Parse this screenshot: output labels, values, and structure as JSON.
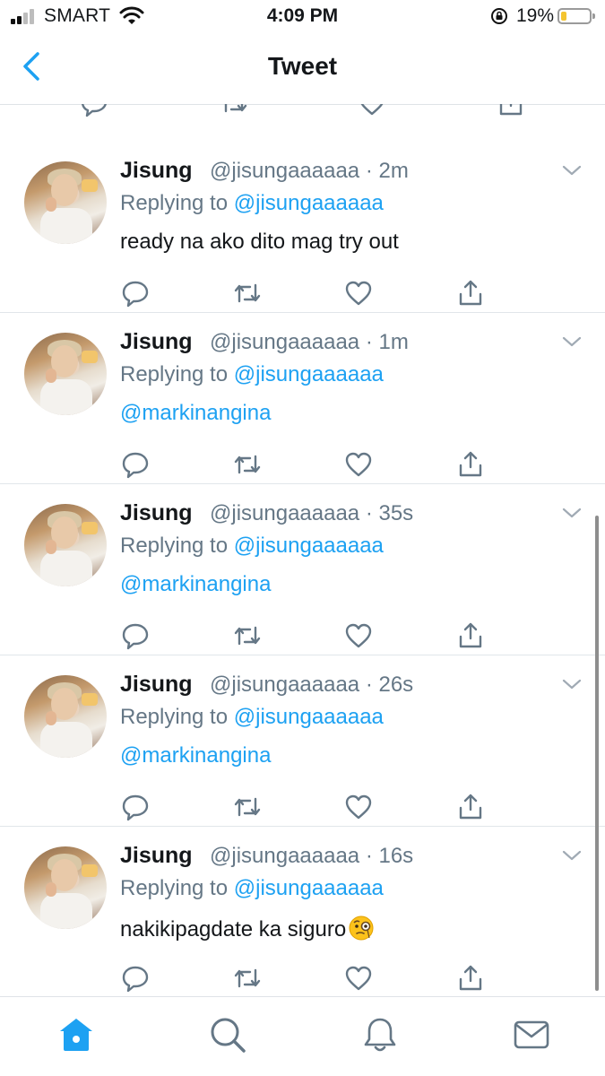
{
  "status_bar": {
    "carrier": "SMART",
    "time": "4:09 PM",
    "battery_percent": "19%",
    "battery_level": 0.19
  },
  "nav": {
    "title": "Tweet"
  },
  "tweets": [
    {
      "name": "Jisung",
      "handle_time": "@jisungaaaaaa · 2m",
      "replying_prefix": "Replying to ",
      "replying_to": "@jisungaaaaaa",
      "text": "ready na ako dito mag try out",
      "is_mention": false
    },
    {
      "name": "Jisung",
      "handle_time": "@jisungaaaaaa · 1m",
      "replying_prefix": "Replying to ",
      "replying_to": "@jisungaaaaaa",
      "text": "@markinangina",
      "is_mention": true
    },
    {
      "name": "Jisung",
      "handle_time": "@jisungaaaaaa · 35s",
      "replying_prefix": "Replying to ",
      "replying_to": "@jisungaaaaaa",
      "text": "@markinangina",
      "is_mention": true
    },
    {
      "name": "Jisung",
      "handle_time": "@jisungaaaaaa · 26s",
      "replying_prefix": "Replying to ",
      "replying_to": "@jisungaaaaaa",
      "text": "@markinangina",
      "is_mention": true
    },
    {
      "name": "Jisung",
      "handle_time": "@jisungaaaaaa · 16s",
      "replying_prefix": "Replying to ",
      "replying_to": "@jisungaaaaaa",
      "text": "nakikipagdate ka siguro",
      "is_mention": false,
      "emoji": "face-with-monocle"
    }
  ],
  "colors": {
    "accent": "#1da1f2",
    "secondary_text": "#657786",
    "primary_text": "#14171a",
    "divider": "#e1e6ea"
  },
  "icons": {
    "back": "chevron-left-icon",
    "caret": "chevron-down-icon",
    "reply": "reply-bubble-icon",
    "retweet": "retweet-icon",
    "like": "heart-icon",
    "share": "share-icon",
    "tabs": [
      "home-icon",
      "search-icon",
      "bell-icon",
      "envelope-icon"
    ]
  }
}
